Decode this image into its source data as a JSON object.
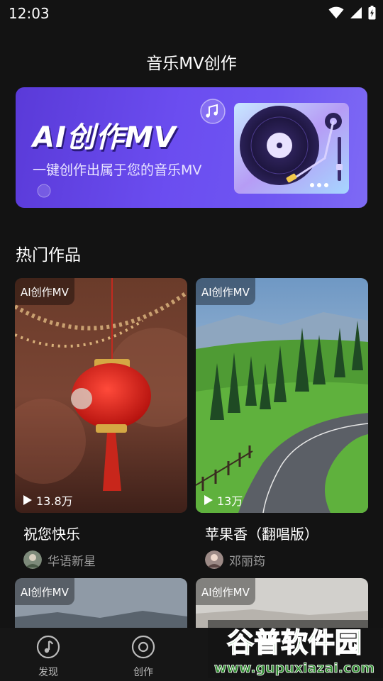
{
  "status": {
    "time": "12:03"
  },
  "page_title": "音乐MV创作",
  "banner": {
    "title": "AI创作MV",
    "subtitle": "一键创作出属于您的音乐MV"
  },
  "section_title": "热门作品",
  "works": [
    {
      "tag": "AI创作MV",
      "plays": "13.8万",
      "title": "祝您快乐",
      "author": "华语新星"
    },
    {
      "tag": "AI创作MV",
      "plays": "13万",
      "title": "苹果香（翻唱版）",
      "author": "邓丽筠"
    },
    {
      "tag": "AI创作MV"
    },
    {
      "tag": "AI创作MV"
    }
  ],
  "nav": [
    {
      "label": "发现",
      "icon": "music-note-icon"
    },
    {
      "label": "创作",
      "icon": "disc-icon"
    }
  ],
  "watermark": {
    "title": "谷普软件园",
    "url": "www.gupuxiazai.com"
  },
  "colors": {
    "background": "#131313",
    "banner": "#6b4df0",
    "secondary_text": "#9a9a9a"
  }
}
